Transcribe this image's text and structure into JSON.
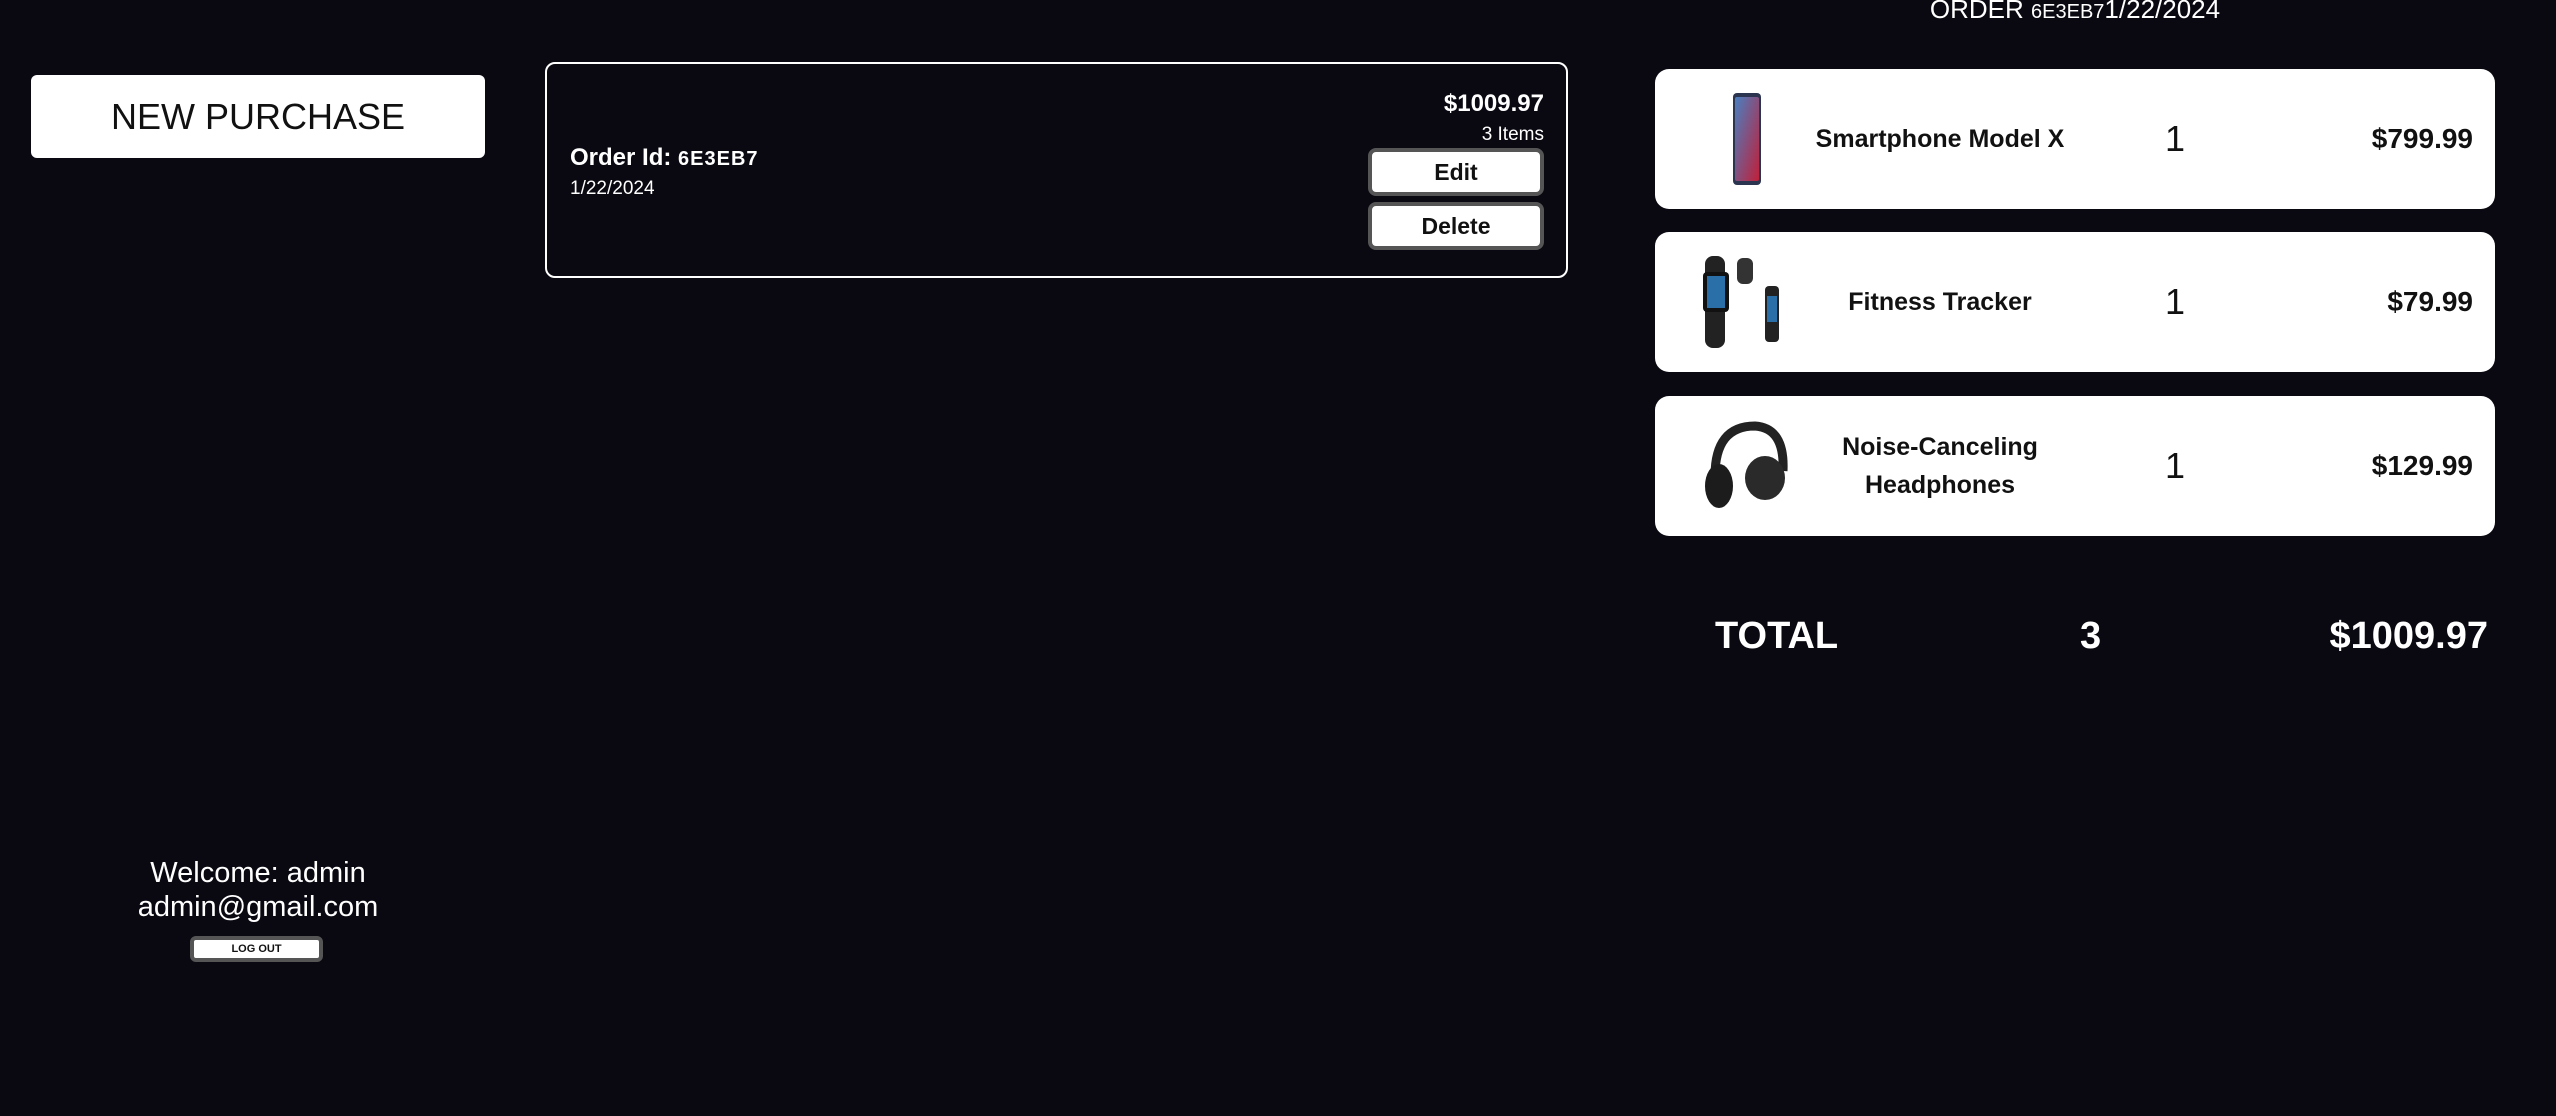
{
  "sidebar": {
    "new_purchase_label": "NEW PURCHASE",
    "welcome": "Welcome: admin",
    "email": "admin@gmail.com",
    "logout_label": "LOG OUT"
  },
  "order_card": {
    "id_label": "Order Id:",
    "id": "6E3EB7",
    "date": "1/22/2024",
    "total": "$1009.97",
    "items_count": "3 Items",
    "edit_label": "Edit",
    "delete_label": "Delete"
  },
  "detail": {
    "header_prefix": "ORDER",
    "header_id": "6E3EB7",
    "header_date": "1/22/2024",
    "items": [
      {
        "name": "Smartphone Model X",
        "qty": "1",
        "price": "$799.99",
        "icon": "smartphone-image"
      },
      {
        "name": "Fitness Tracker",
        "qty": "1",
        "price": "$79.99",
        "icon": "fitness-tracker-image"
      },
      {
        "name": "Noise-Canceling Headphones",
        "qty": "1",
        "price": "$129.99",
        "icon": "headphones-image"
      }
    ],
    "total_label": "TOTAL",
    "total_qty": "3",
    "total_price": "$1009.97"
  }
}
